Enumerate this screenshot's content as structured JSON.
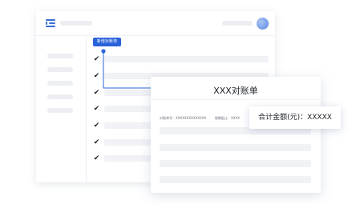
{
  "app": {
    "new_button_label": "新增对账单",
    "rows": [
      {
        "check": "✔"
      },
      {
        "check": "✔"
      },
      {
        "check": "✔"
      },
      {
        "check": "✔"
      },
      {
        "check": "✔"
      },
      {
        "check": "✔"
      },
      {
        "check": "✔"
      }
    ]
  },
  "detail": {
    "title": "XXX对账单",
    "meta_left": "对账单号：XXXXXXXXXXXXXX",
    "meta_right": "账期起止：XXXX"
  },
  "total": {
    "label": "合计金额(元)：XXXXX"
  },
  "colors": {
    "accent": "#2a63d9",
    "placeholder": "#eceef2",
    "row_placeholder": "#f1f2f5"
  },
  "icons": [
    "menu-icon",
    "avatar",
    "check-icon"
  ]
}
